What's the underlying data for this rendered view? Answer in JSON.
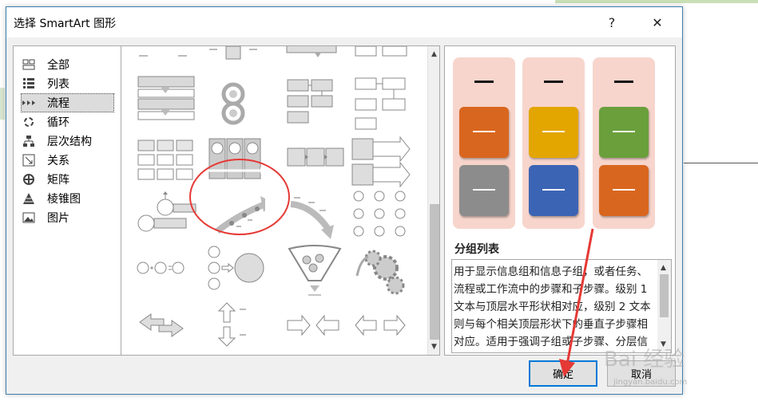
{
  "dialog": {
    "title": "选择 SmartArt 图形",
    "help_label": "?",
    "close_label": "✕"
  },
  "categories": [
    {
      "label": "全部",
      "icon": "all-icon"
    },
    {
      "label": "列表",
      "icon": "list-icon"
    },
    {
      "label": "流程",
      "icon": "process-icon",
      "selected": true
    },
    {
      "label": "循环",
      "icon": "cycle-icon"
    },
    {
      "label": "层次结构",
      "icon": "hierarchy-icon"
    },
    {
      "label": "关系",
      "icon": "relationship-icon"
    },
    {
      "label": "矩阵",
      "icon": "matrix-icon"
    },
    {
      "label": "棱锥图",
      "icon": "pyramid-icon"
    },
    {
      "label": "图片",
      "icon": "picture-icon"
    }
  ],
  "preview": {
    "layout_name": "分组列表",
    "description": "用于显示信息组和信息子组，或者任务、流程或工作流中的步骤和子步骤。级别 1 文本与顶层水平形状相对应，级别 2 文本则与每个相关顶层形状下的垂直子步骤相对应。适用于强调子组或子步骤、分层信息或多信息",
    "colors": {
      "column_bg": "#f7d5cc",
      "orange": "#d9661f",
      "gray": "#8c8c8c",
      "gold": "#e3a500",
      "blue": "#3c64b4",
      "green": "#6a9f3c"
    }
  },
  "buttons": {
    "ok": "确定",
    "cancel": "取消"
  },
  "watermark": {
    "text": "Bai 经验",
    "sub": "jingyan.baidu.com"
  },
  "annotation_colors": {
    "highlight": "#e53935"
  }
}
